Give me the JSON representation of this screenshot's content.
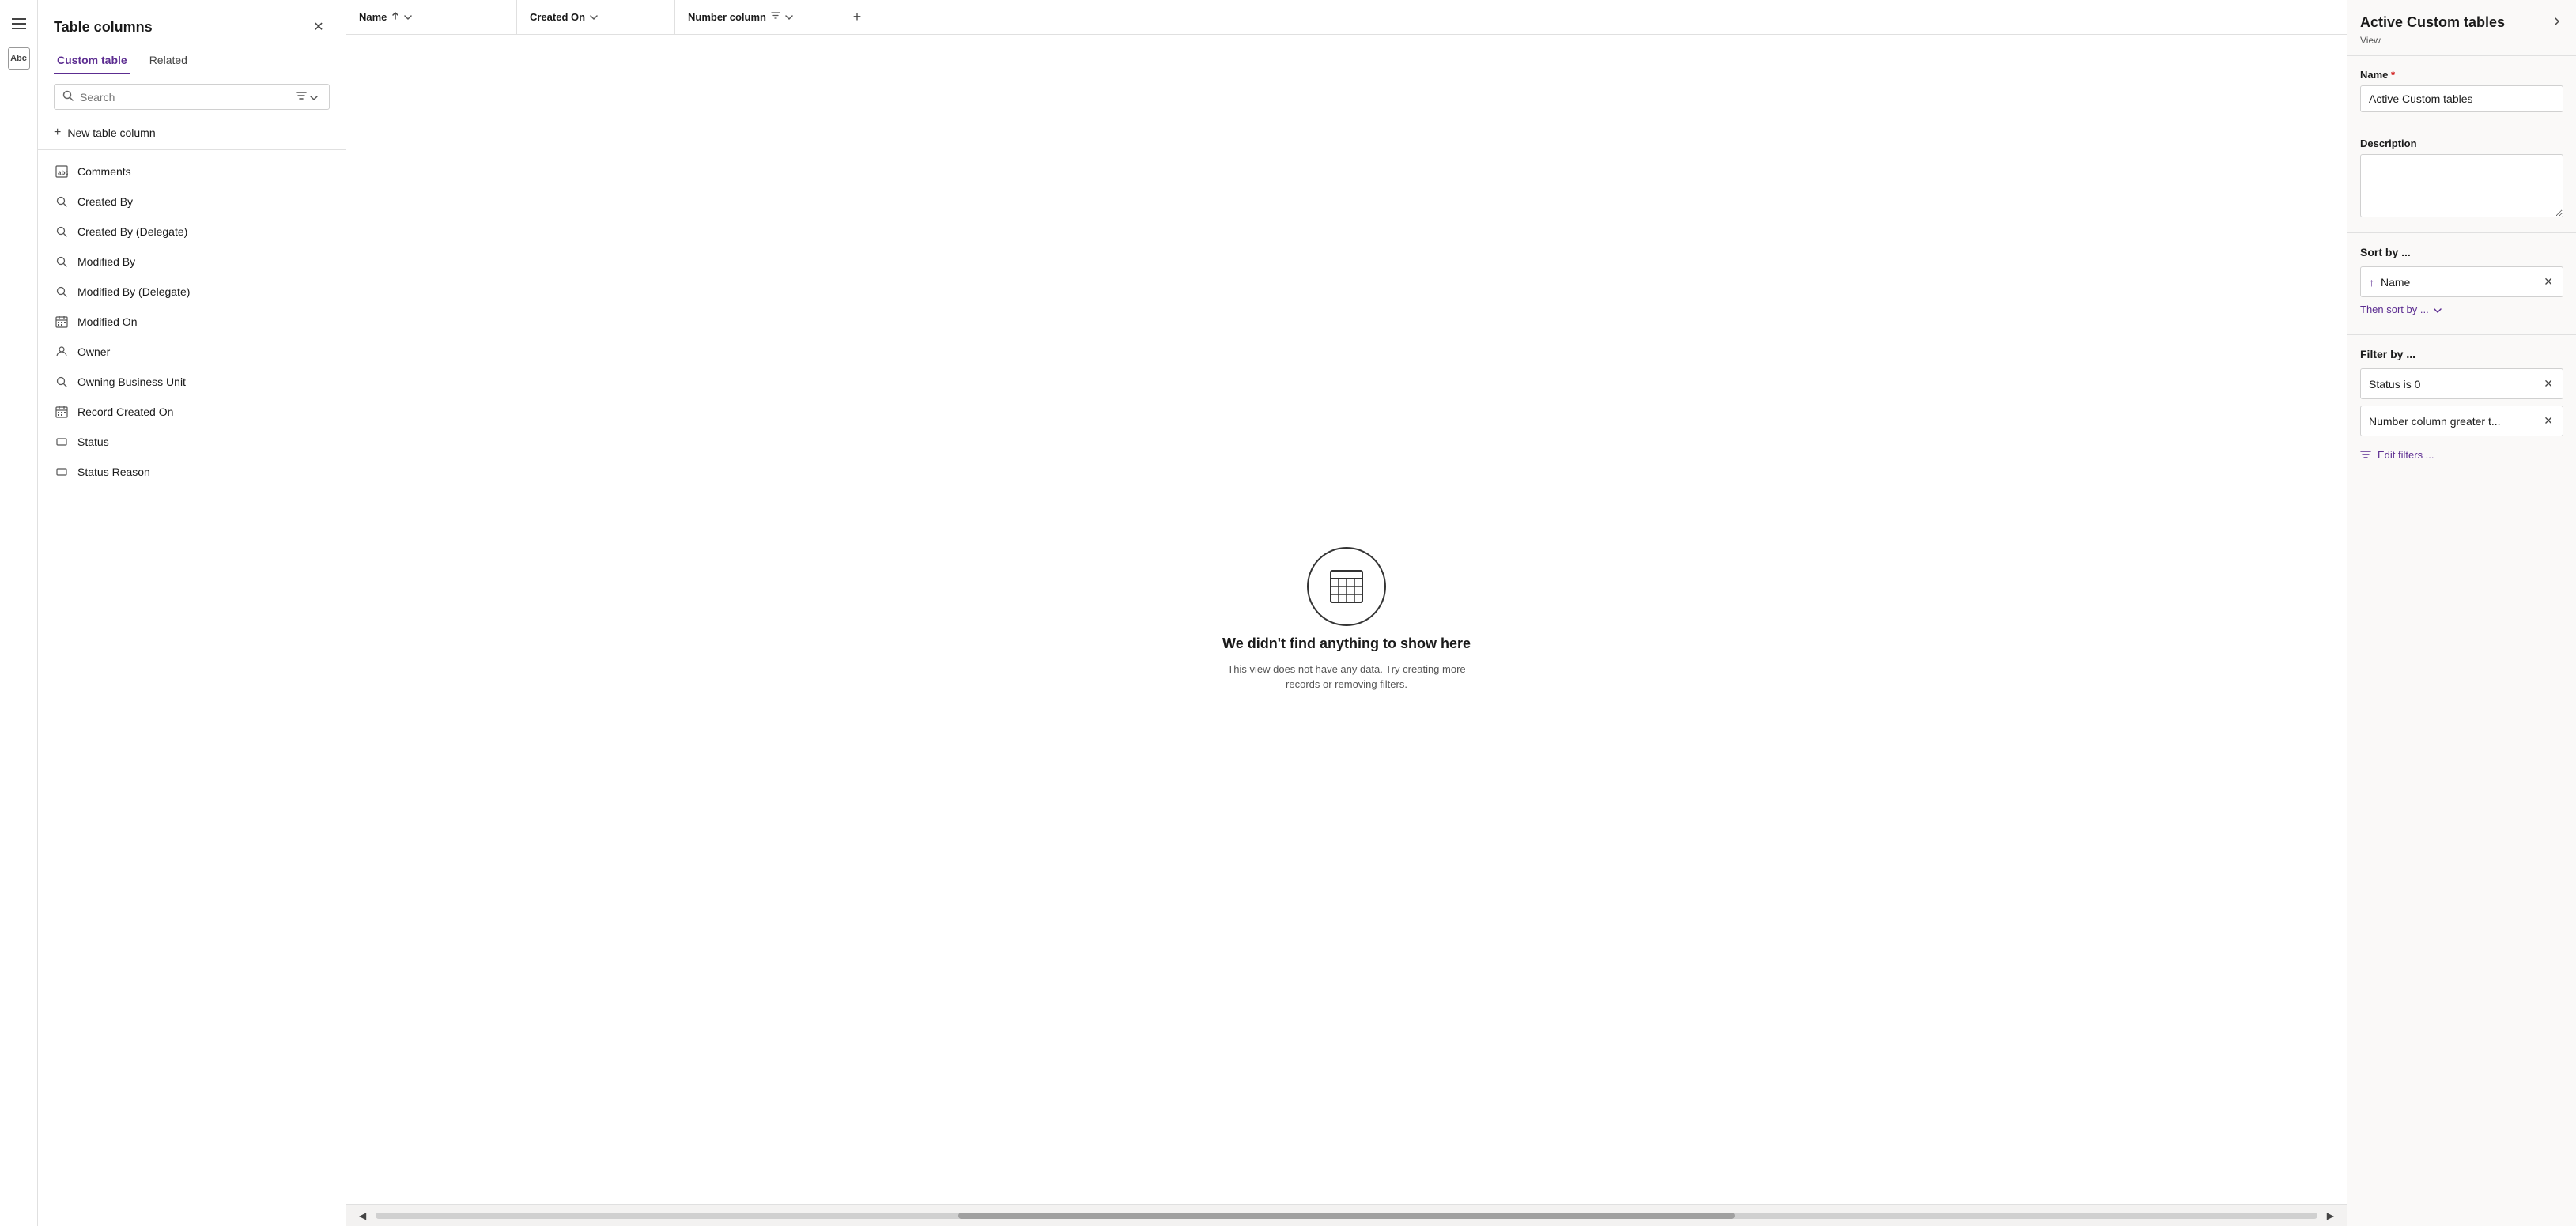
{
  "nav": {
    "hamburger_icon": "☰",
    "abc_icon": "Abc"
  },
  "left_panel": {
    "title": "Table columns",
    "close_icon": "✕",
    "tabs": [
      {
        "id": "custom_table",
        "label": "Custom table",
        "active": true
      },
      {
        "id": "related",
        "label": "Related",
        "active": false
      }
    ],
    "search_placeholder": "Search",
    "filter_icon": "⊿",
    "new_column_label": "New table column",
    "columns": [
      {
        "id": "comments",
        "label": "Comments",
        "icon": "abc"
      },
      {
        "id": "created_by",
        "label": "Created By",
        "icon": "search"
      },
      {
        "id": "created_by_delegate",
        "label": "Created By (Delegate)",
        "icon": "search"
      },
      {
        "id": "modified_by",
        "label": "Modified By",
        "icon": "search"
      },
      {
        "id": "modified_by_delegate",
        "label": "Modified By (Delegate)",
        "icon": "search"
      },
      {
        "id": "modified_on",
        "label": "Modified On",
        "icon": "calendar"
      },
      {
        "id": "owner",
        "label": "Owner",
        "icon": "person"
      },
      {
        "id": "owning_business_unit",
        "label": "Owning Business Unit",
        "icon": "search"
      },
      {
        "id": "record_created_on",
        "label": "Record Created On",
        "icon": "calendar"
      },
      {
        "id": "status",
        "label": "Status",
        "icon": "rect"
      },
      {
        "id": "status_reason",
        "label": "Status Reason",
        "icon": "rect"
      }
    ]
  },
  "grid": {
    "columns": [
      {
        "id": "name",
        "label": "Name",
        "has_sort": true,
        "sort_dir": "asc",
        "has_filter": false
      },
      {
        "id": "created_on",
        "label": "Created On",
        "has_sort": true,
        "sort_dir": "desc",
        "has_filter": false
      },
      {
        "id": "number_column",
        "label": "Number column",
        "has_sort": false,
        "sort_dir": null,
        "has_filter": true
      }
    ],
    "add_col_icon": "+",
    "empty_state": {
      "title": "We didn't find anything to show here",
      "subtitle": "This view does not have any data. Try creating more records or removing filters."
    }
  },
  "right_panel": {
    "title": "Active Custom tables",
    "expand_icon": "❯",
    "subtitle": "View",
    "name_label": "Name",
    "name_required": true,
    "name_value": "Active Custom tables",
    "description_label": "Description",
    "description_value": "",
    "sort_by_label": "Sort by ...",
    "sort_name": "Name",
    "then_sort_label": "Then sort by ...",
    "filter_by_label": "Filter by ...",
    "filters": [
      {
        "id": "status_filter",
        "text": "Status is 0"
      },
      {
        "id": "number_filter",
        "text": "Number column greater t..."
      }
    ],
    "edit_filters_label": "Edit filters ..."
  }
}
